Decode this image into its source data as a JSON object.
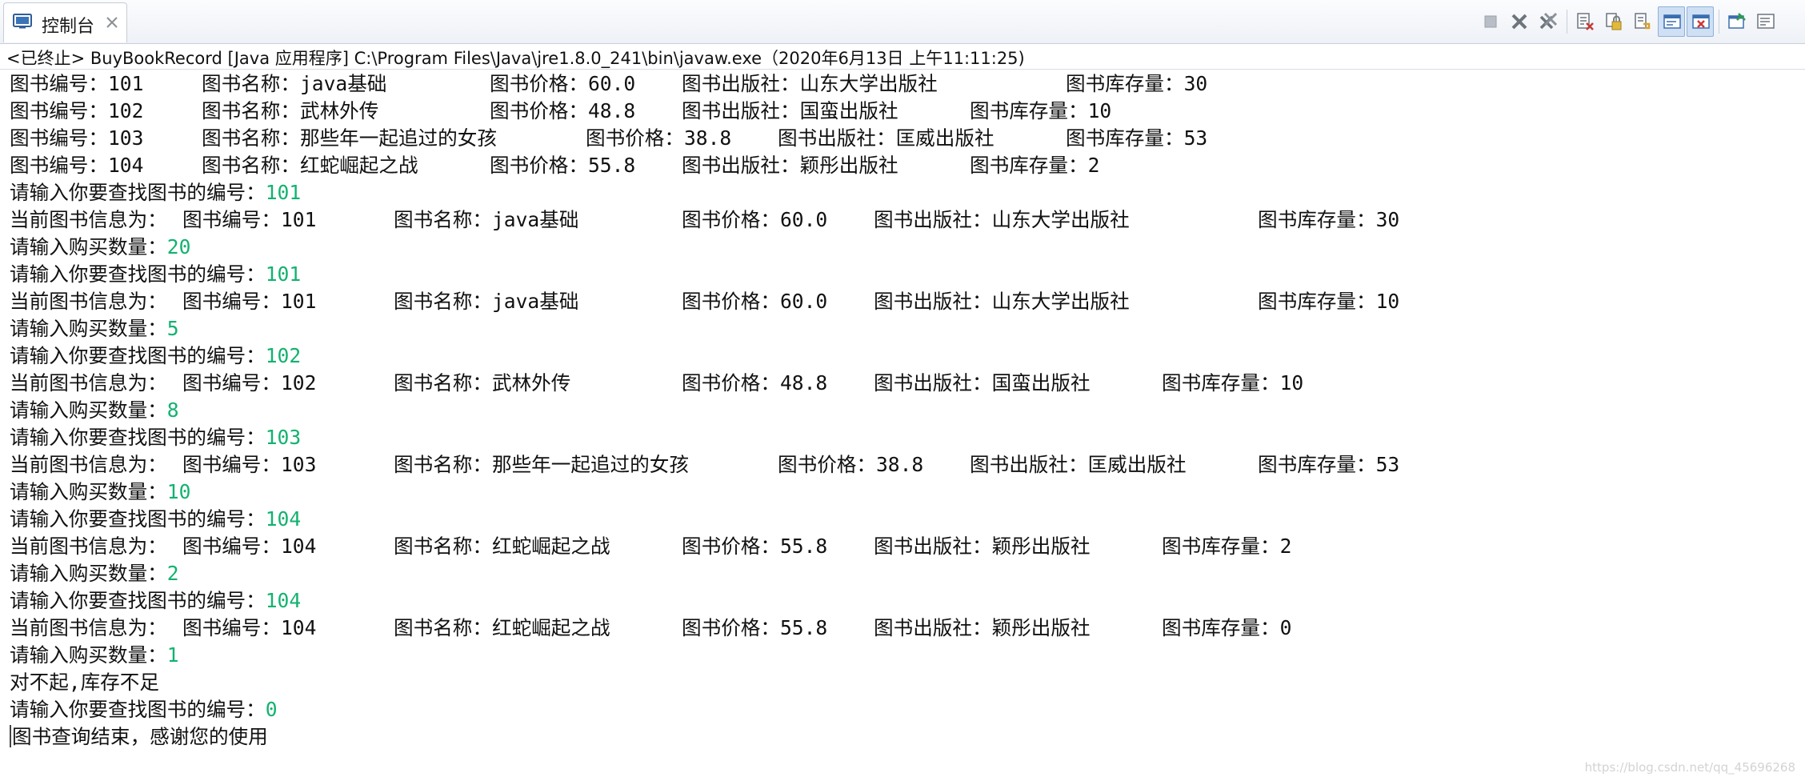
{
  "tab": {
    "label": "控制台",
    "icon": "console-icon",
    "close_icon": "close-icon"
  },
  "toolbar": {
    "icons": [
      "terminate-icon",
      "remove-launch-icon",
      "remove-all-terminated-icon",
      "clear-console-icon",
      "scroll-lock-icon",
      "word-wrap-icon",
      "show-on-stdout-icon",
      "show-on-stderr-icon",
      "pin-console-icon",
      "display-console-icon"
    ]
  },
  "status_line": "<已终止> BuyBookRecord [Java 应用程序] C:\\Program Files\\Java\\jre1.8.0_241\\bin\\javaw.exe（2020年6月13日 上午11:11:25)",
  "book_list": [
    {
      "id": "图书编号：101",
      "name": "图书名称：java基础",
      "price": "图书价格：60.0",
      "publisher": "图书出版社：山东大学出版社",
      "stock": "图书库存量：30"
    },
    {
      "id": "图书编号：102",
      "name": "图书名称：武林外传",
      "price": "图书价格：48.8",
      "publisher": "图书出版社：国蛮出版社",
      "stock": "图书库存量：10"
    },
    {
      "id": "图书编号：103",
      "name": "图书名称：那些年一起追过的女孩",
      "price": "图书价格：38.8",
      "publisher": "图书出版社：匡威出版社",
      "stock": "图书库存量：53"
    },
    {
      "id": "图书编号：104",
      "name": "图书名称：红蛇崛起之战",
      "price": "图书价格：55.8",
      "publisher": "图书出版社：颖彤出版社",
      "stock": "图书库存量：2"
    }
  ],
  "prompts": {
    "search_prompt": "请输入你要查找图书的编号：",
    "quantity_prompt": "请输入购买数量：",
    "current_info": "当前图书信息为："
  },
  "transactions": [
    {
      "search_input": "101",
      "info": {
        "id": "图书编号：101",
        "name": "图书名称：java基础",
        "price": "图书价格：60.0",
        "publisher": "图书出版社：山东大学出版社",
        "stock": "图书库存量：30"
      },
      "quantity_input": "20"
    },
    {
      "search_input": "101",
      "info": {
        "id": "图书编号：101",
        "name": "图书名称：java基础",
        "price": "图书价格：60.0",
        "publisher": "图书出版社：山东大学出版社",
        "stock": "图书库存量：10"
      },
      "quantity_input": "5"
    },
    {
      "search_input": "102",
      "info": {
        "id": "图书编号：102",
        "name": "图书名称：武林外传",
        "price": "图书价格：48.8",
        "publisher": "图书出版社：国蛮出版社",
        "stock": "图书库存量：10"
      },
      "quantity_input": "8"
    },
    {
      "search_input": "103",
      "info": {
        "id": "图书编号：103",
        "name": "图书名称：那些年一起追过的女孩",
        "price": "图书价格：38.8",
        "publisher": "图书出版社：匡威出版社",
        "stock": "图书库存量：53"
      },
      "quantity_input": "10"
    },
    {
      "search_input": "104",
      "info": {
        "id": "图书编号：104",
        "name": "图书名称：红蛇崛起之战",
        "price": "图书价格：55.8",
        "publisher": "图书出版社：颖彤出版社",
        "stock": "图书库存量：2"
      },
      "quantity_input": "2"
    },
    {
      "search_input": "104",
      "info": {
        "id": "图书编号：104",
        "name": "图书名称：红蛇崛起之战",
        "price": "图书价格：55.8",
        "publisher": "图书出版社：颖彤出版社",
        "stock": "图书库存量：0"
      },
      "quantity_input": "1"
    }
  ],
  "out_of_stock_message": "对不起,库存不足",
  "final_search_input": "0",
  "end_message": "图书查询结束，感谢您的使用",
  "watermark": "https://blog.csdn.net/qq_45696268",
  "colors": {
    "user_input": "#12b26f",
    "output_text": "#111111"
  }
}
